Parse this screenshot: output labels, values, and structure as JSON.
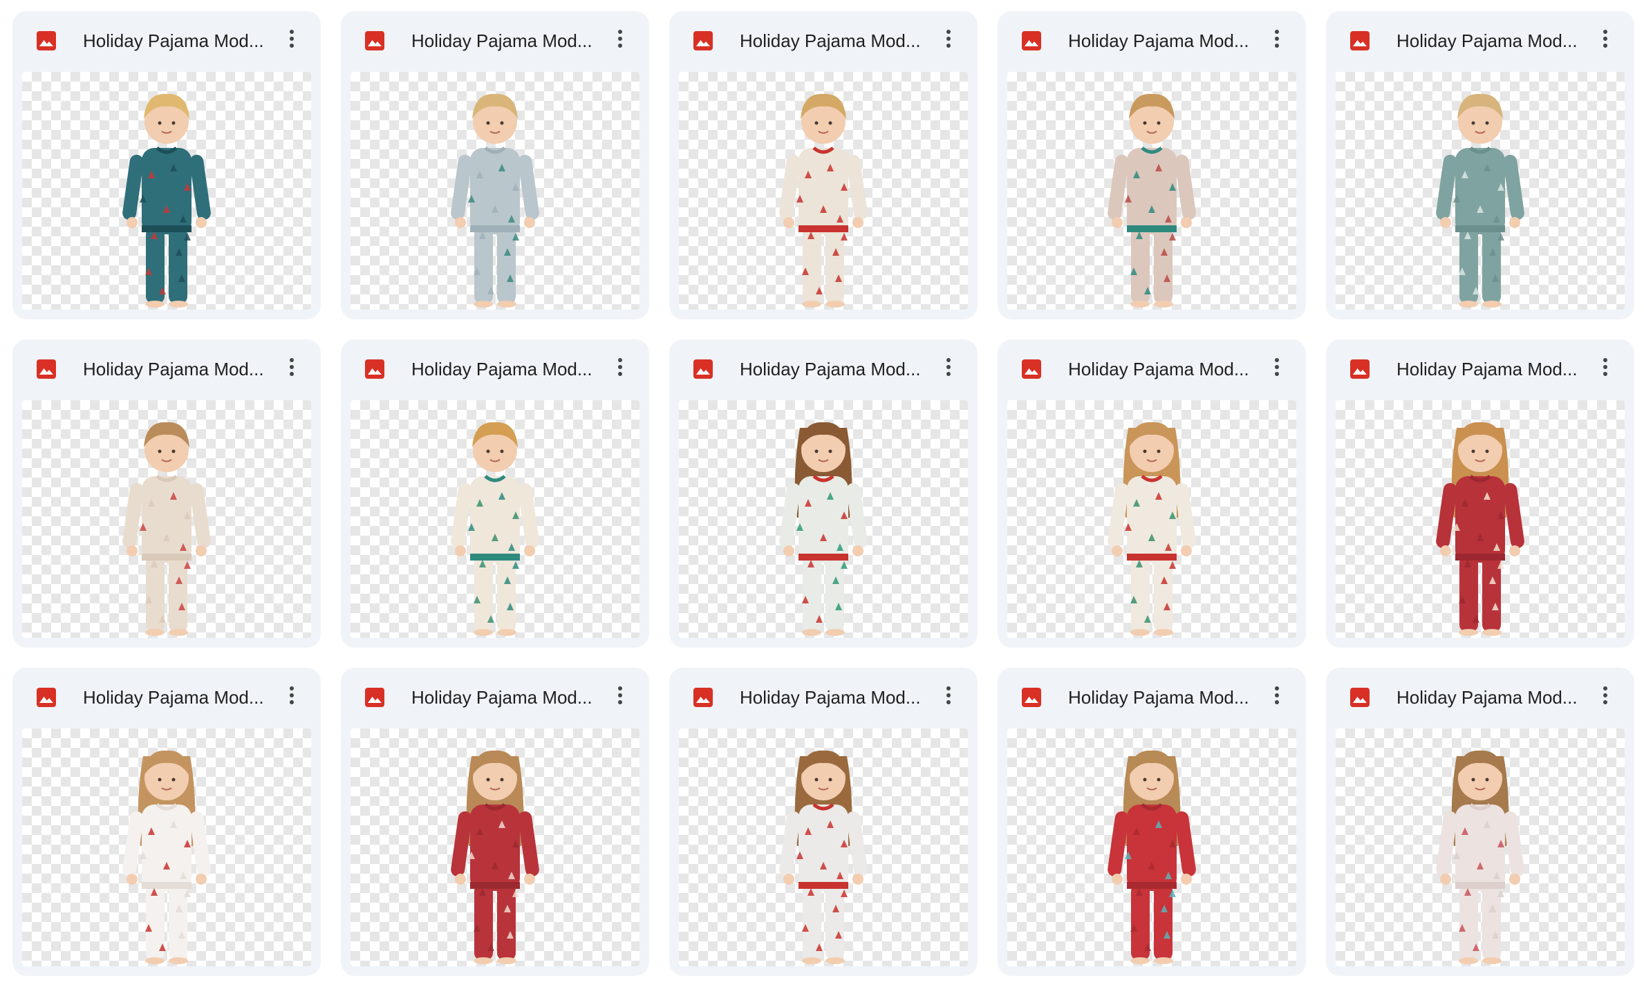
{
  "files": [
    {
      "name": "Holiday Pajama Mod...",
      "icon": "image-file-icon",
      "palette": {
        "pj": "#2f6f7a",
        "accent": "#c23a3a",
        "trim": "#1d4f58",
        "hair": "#e0b870",
        "long_hair": false
      }
    },
    {
      "name": "Holiday Pajama Mod...",
      "icon": "image-file-icon",
      "palette": {
        "pj": "#b9c6cc",
        "accent": "#3b8a80",
        "trim": "#9fb0b8",
        "hair": "#d9b57a",
        "long_hair": false
      }
    },
    {
      "name": "Holiday Pajama Mod...",
      "icon": "image-file-icon",
      "palette": {
        "pj": "#ece4d8",
        "accent": "#c8332f",
        "trim": "#c8332f",
        "hair": "#d4a865",
        "long_hair": false
      }
    },
    {
      "name": "Holiday Pajama Mod...",
      "icon": "image-file-icon",
      "palette": {
        "pj": "#dcc7bd",
        "accent": "#b84a45",
        "trim": "#2f8a7e",
        "hair": "#c99a5e",
        "long_hair": false
      }
    },
    {
      "name": "Holiday Pajama Mod...",
      "icon": "image-file-icon",
      "palette": {
        "pj": "#7fa3a0",
        "accent": "#dbe6e3",
        "trim": "#6a8f8c",
        "hair": "#d6b47c",
        "long_hair": false
      }
    },
    {
      "name": "Holiday Pajama Mod...",
      "icon": "image-file-icon",
      "palette": {
        "pj": "#e8dccf",
        "accent": "#c9453f",
        "trim": "#d9c9b9",
        "hair": "#b98c5a",
        "long_hair": false
      }
    },
    {
      "name": "Holiday Pajama Mod...",
      "icon": "image-file-icon",
      "palette": {
        "pj": "#efe7da",
        "accent": "#3c8f70",
        "trim": "#2f8a7e",
        "hair": "#d49f52",
        "long_hair": false
      }
    },
    {
      "name": "Holiday Pajama Mod...",
      "icon": "image-file-icon",
      "palette": {
        "pj": "#e9ece6",
        "accent": "#2f9a78",
        "trim": "#c8332f",
        "hair": "#8a5a34",
        "long_hair": true
      }
    },
    {
      "name": "Holiday Pajama Mod...",
      "icon": "image-file-icon",
      "palette": {
        "pj": "#f0e9df",
        "accent": "#3a8f6e",
        "trim": "#c8332f",
        "hair": "#c99559",
        "long_hair": true
      }
    },
    {
      "name": "Holiday Pajama Mod...",
      "icon": "image-file-icon",
      "palette": {
        "pj": "#b8323a",
        "accent": "#f1e3d0",
        "trim": "#9c2730",
        "hair": "#c9904f",
        "long_hair": true
      }
    },
    {
      "name": "Holiday Pajama Mod...",
      "icon": "image-file-icon",
      "palette": {
        "pj": "#f4f1ee",
        "accent": "#c8332f",
        "trim": "#e4dcd6",
        "hair": "#c49460",
        "long_hair": true
      }
    },
    {
      "name": "Holiday Pajama Mod...",
      "icon": "image-file-icon",
      "palette": {
        "pj": "#b8343a",
        "accent": "#f0d9d0",
        "trim": "#9b2a30",
        "hair": "#b98a57",
        "long_hair": true
      }
    },
    {
      "name": "Holiday Pajama Mod...",
      "icon": "image-file-icon",
      "palette": {
        "pj": "#eceae8",
        "accent": "#c8332f",
        "trim": "#c8332f",
        "hair": "#9a6a3e",
        "long_hair": true
      }
    },
    {
      "name": "Holiday Pajama Mod...",
      "icon": "image-file-icon",
      "palette": {
        "pj": "#c8343a",
        "accent": "#5bb3b8",
        "trim": "#a82a30",
        "hair": "#b88a55",
        "long_hair": true
      }
    },
    {
      "name": "Holiday Pajama Mod...",
      "icon": "image-file-icon",
      "palette": {
        "pj": "#ece2e0",
        "accent": "#c9545a",
        "trim": "#dccfcc",
        "hair": "#a67a4c",
        "long_hair": true
      }
    }
  ],
  "more_actions_icon": "more-vert-icon"
}
